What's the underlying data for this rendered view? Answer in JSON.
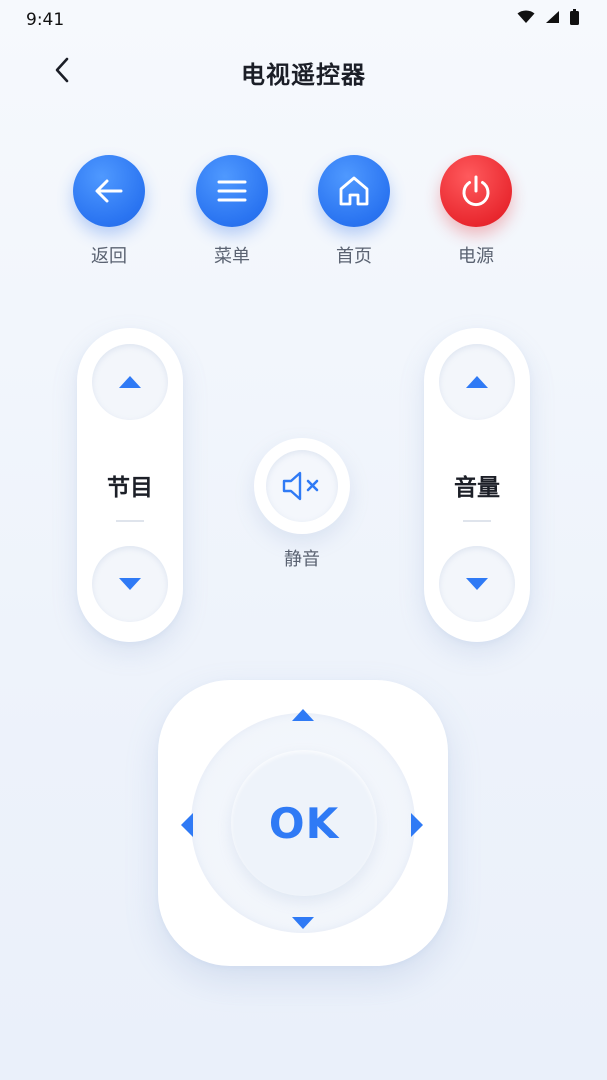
{
  "status_bar": {
    "time": "9:41",
    "icons": [
      "wifi-icon",
      "signal-icon",
      "battery-icon"
    ]
  },
  "header": {
    "title": "电视遥控器",
    "back_icon": "chevron-left-icon"
  },
  "quick_buttons": [
    {
      "label": "返回",
      "icon": "arrow-left-icon",
      "color": "#2a74f1"
    },
    {
      "label": "菜单",
      "icon": "menu-icon",
      "color": "#2a74f1"
    },
    {
      "label": "首页",
      "icon": "home-icon",
      "color": "#2a74f1"
    },
    {
      "label": "电源",
      "icon": "power-icon",
      "color": "#e8262d"
    }
  ],
  "channel": {
    "label": "节目",
    "up_icon": "triangle-up-icon",
    "down_icon": "triangle-down-icon"
  },
  "volume": {
    "label": "音量",
    "up_icon": "triangle-up-icon",
    "down_icon": "triangle-down-icon"
  },
  "mute": {
    "label": "静音",
    "icon": "speaker-mute-icon"
  },
  "dpad": {
    "ok_label": "OK"
  },
  "colors": {
    "accent": "#2f7af5",
    "power": "#e8262d",
    "label": "#5b6372"
  }
}
